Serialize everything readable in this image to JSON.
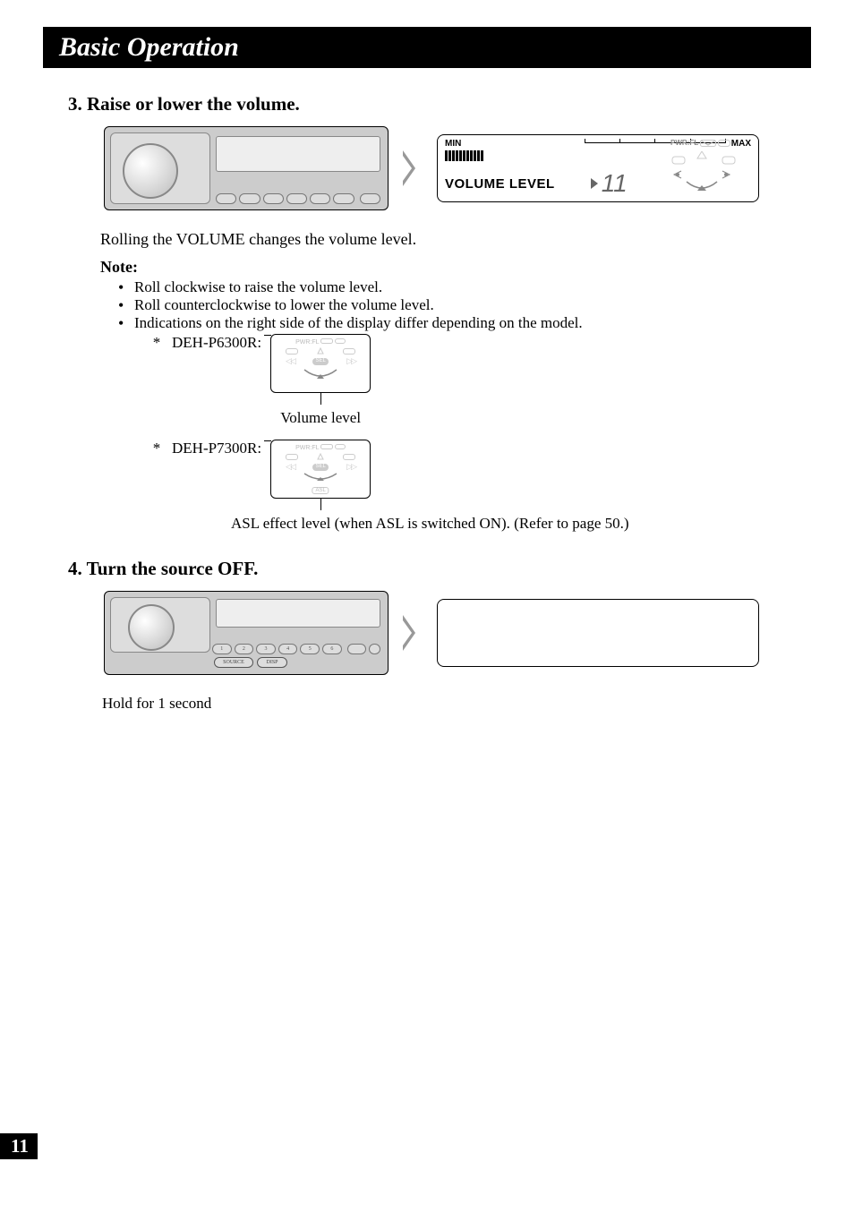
{
  "header": {
    "title": "Basic Operation"
  },
  "section3": {
    "number": "3.",
    "heading": "Raise or lower the volume.",
    "lcd": {
      "min": "MIN",
      "max": "MAX",
      "pwrfl": "PWR:FL",
      "volume_label": "VOLUME LEVEL",
      "volume_value": "11"
    },
    "body": "Rolling the VOLUME changes the volume level.",
    "note_label": "Note:",
    "bullets": [
      "Roll clockwise to raise the volume level.",
      "Roll counterclockwise to lower the volume level.",
      "Indications on the right side of the display differ depending on the model."
    ],
    "model1": {
      "name": "DEH-P6300R:",
      "pwrfl": "PWR:FL",
      "sel": "SEL",
      "caption": "Volume level"
    },
    "model2": {
      "name": "DEH-P7300R:",
      "pwrfl": "PWR:FL",
      "sel": "SEL",
      "asl": "ASL",
      "caption": "ASL effect level (when ASL is switched ON). (Refer to page 50.)"
    }
  },
  "section4": {
    "number": "4.",
    "heading": "Turn the source OFF.",
    "buttons": {
      "source": "SOURCE",
      "disp": "DISP",
      "nums": [
        "1",
        "2",
        "3",
        "4",
        "5",
        "6"
      ]
    },
    "caption": "Hold for 1 second"
  },
  "page_number": "11"
}
